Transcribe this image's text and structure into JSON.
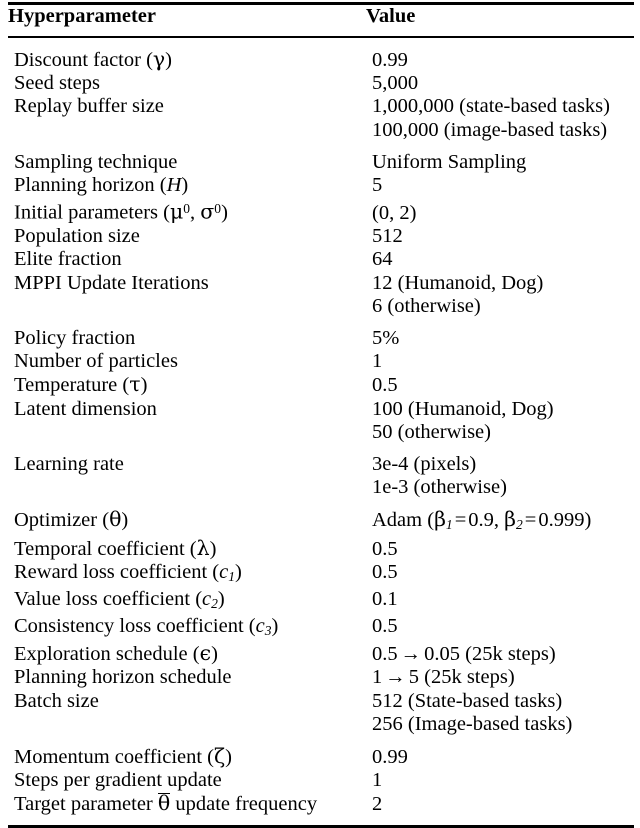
{
  "table": {
    "columns": [
      "Hyperparameter",
      "Value"
    ],
    "rows": [
      {
        "param": "Discount factor (γ)",
        "param_html": "Discount factor (<span class=\"mi greek\">γ</span>)",
        "values": [
          "0.99"
        ],
        "gap_before": false
      },
      {
        "param": "Seed steps",
        "param_html": "Seed steps",
        "values": [
          "5,000"
        ],
        "gap_before": false
      },
      {
        "param": "Replay buffer size",
        "param_html": "Replay buffer size",
        "values": [
          "1,000,000 (state-based tasks)",
          "100,000 (image-based tasks)"
        ],
        "gap_before": false
      },
      {
        "param": "Sampling technique",
        "param_html": "Sampling technique",
        "values": [
          "Uniform Sampling"
        ],
        "gap_before": true
      },
      {
        "param": "Planning horizon (H)",
        "param_html": "Planning horizon (<span class=\"mi\">H</span>)",
        "values": [
          "5"
        ],
        "gap_before": false
      },
      {
        "param": "Initial parameters (μ0, σ0)",
        "param_html": "Initial parameters (<span class=\"mi greek\">μ</span><sup class=\"sp\">0</sup>, <span class=\"mi greek\">σ</span><sup class=\"sp\">0</sup>)",
        "values": [
          "(0, 2)"
        ],
        "gap_before": false
      },
      {
        "param": "Population size",
        "param_html": "Population size",
        "values": [
          "512"
        ],
        "gap_before": false
      },
      {
        "param": "Elite fraction",
        "param_html": "Elite fraction",
        "values": [
          "64"
        ],
        "gap_before": false
      },
      {
        "param": "MPPI Update Iterations",
        "param_html": "MPPI Update Iterations",
        "values": [
          "12 (Humanoid, Dog)",
          "6 (otherwise)"
        ],
        "gap_before": false
      },
      {
        "param": "Policy fraction",
        "param_html": "Policy fraction",
        "values": [
          "5%"
        ],
        "gap_before": true
      },
      {
        "param": "Number of particles",
        "param_html": "Number of particles",
        "values": [
          "1"
        ],
        "gap_before": false
      },
      {
        "param": "Temperature (τ)",
        "param_html": "Temperature (<span class=\"mi greek\">τ</span>)",
        "values": [
          "0.5"
        ],
        "gap_before": false
      },
      {
        "param": "Latent dimension",
        "param_html": "Latent dimension",
        "values": [
          "100 (Humanoid, Dog)",
          "50 (otherwise)"
        ],
        "gap_before": false
      },
      {
        "param": "Learning rate",
        "param_html": "Learning rate",
        "values": [
          "3e-4 (pixels)",
          "1e-3 (otherwise)"
        ],
        "gap_before": true
      },
      {
        "param": "Optimizer (θ)",
        "param_html": "Optimizer (<span class=\"mi greek\">θ</span>)",
        "values": [
          "Adam (β1 = 0.9, β2 = 0.999)"
        ],
        "value_html": [
          "Adam (<span class=\"mi greek\">β</span><sub class=\"sb\">1</sub><span class=\"eq\">=</span>0.9, <span class=\"mi greek\">β</span><sub class=\"sb\">2</sub><span class=\"eq\">=</span>0.999)"
        ],
        "gap_before": true
      },
      {
        "param": "Temporal coefficient (λ)",
        "param_html": "Temporal coefficient (<span class=\"mi greek\">λ</span>)",
        "values": [
          "0.5"
        ],
        "gap_before": false
      },
      {
        "param": "Reward loss coefficient (c1)",
        "param_html": "Reward loss coefficient (<span class=\"mi\">c</span><sub class=\"sb\">1</sub>)",
        "values": [
          "0.5"
        ],
        "gap_before": false
      },
      {
        "param": "Value loss coefficient (c2)",
        "param_html": "Value loss coefficient (<span class=\"mi\">c</span><sub class=\"sb\">2</sub>)",
        "values": [
          "0.1"
        ],
        "gap_before": false
      },
      {
        "param": "Consistency loss coefficient (c3)",
        "param_html": "Consistency loss coefficient (<span class=\"mi\">c</span><sub class=\"sb\">3</sub>)",
        "values": [
          "0.5"
        ],
        "gap_before": false
      },
      {
        "param": "Exploration schedule (ϵ)",
        "param_html": "Exploration schedule (<span class=\"mi greek\">ϵ</span>)",
        "values": [
          "0.5 → 0.05 (25k steps)"
        ],
        "value_html": [
          "0.5<span class=\"arr\">→</span>0.05 (25k steps)"
        ],
        "gap_before": false
      },
      {
        "param": "Planning horizon schedule",
        "param_html": "Planning horizon schedule",
        "values": [
          "1 → 5 (25k steps)"
        ],
        "value_html": [
          "1<span class=\"arr\">→</span>5 (25k steps)"
        ],
        "gap_before": false
      },
      {
        "param": "Batch size",
        "param_html": "Batch size",
        "values": [
          "512 (State-based tasks)",
          "256 (Image-based tasks)"
        ],
        "gap_before": false
      },
      {
        "param": "Momentum coefficient (ζ)",
        "param_html": "Momentum coefficient (<span class=\"mi greek\">ζ</span>)",
        "values": [
          "0.99"
        ],
        "gap_before": true
      },
      {
        "param": "Steps per gradient update",
        "param_html": "Steps per gradient update",
        "values": [
          "1"
        ],
        "gap_before": false
      },
      {
        "param": "Target parameter θ̄ update frequency",
        "param_html": "Target parameter <span class=\"ovl\"><span class=\"bar\"></span><span class=\"mi greek\">θ</span></span> update frequency",
        "values": [
          "2"
        ],
        "gap_before": false
      }
    ]
  }
}
